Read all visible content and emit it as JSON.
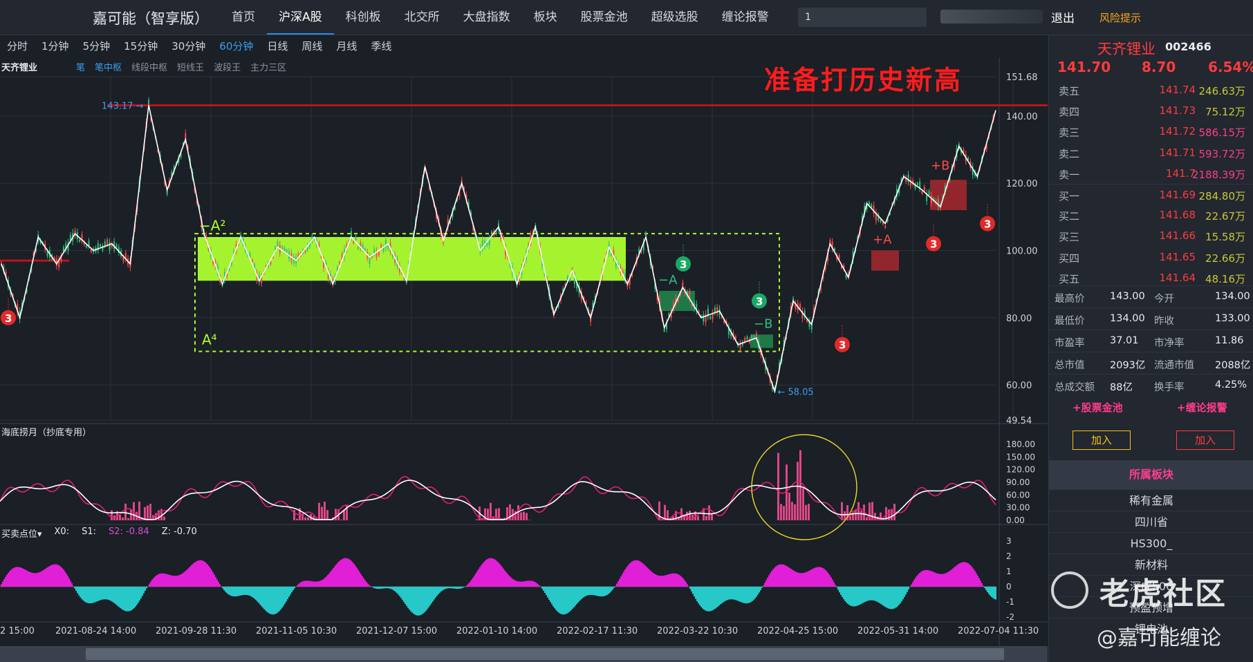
{
  "topbar": {
    "brand": "嘉可能（智享版）",
    "nav": [
      "首页",
      "沪深A股",
      "科创板",
      "北交所",
      "大盘指数",
      "板块",
      "股票金池",
      "超级选股",
      "缠论报警"
    ],
    "nav_active": 1,
    "search_value": "1",
    "logout": "退出",
    "risk": "风险提示"
  },
  "periods": [
    "分时",
    "1分钟",
    "5分钟",
    "15分钟",
    "30分钟",
    "60分钟",
    "日线",
    "周线",
    "月线",
    "季线"
  ],
  "period_active": 5,
  "toolrow": {
    "stock": "天齐锂业",
    "chips": [
      "笔",
      "笔中枢",
      "线段中枢",
      "短线王",
      "波段王",
      "主力三区"
    ],
    "chips_on": [
      0,
      1
    ]
  },
  "headline": "准备打历史新高",
  "chart_data": [
    {
      "type": "line",
      "name": "60-minute price chart",
      "y_ticks": [
        "151.68",
        "140.00",
        "120.00",
        "100.00",
        "80.00",
        "60.00",
        "49.54"
      ],
      "ylim": [
        49.54,
        151.68
      ],
      "x_tick_labels": [
        "2 15:00",
        "2021-08-24 14:00",
        "2021-09-28 11:30",
        "2021-11-05 10:30",
        "2021-12-07 15:00",
        "2022-01-10 14:00",
        "2022-02-17 11:30",
        "2022-03-22 10:30",
        "2022-04-25 15:00",
        "2022-05-31 14:00",
        "2022-07-04 11:30"
      ],
      "stroke_pivots": [
        96,
        80,
        104,
        96,
        105,
        100,
        102,
        96,
        143.17,
        118,
        133,
        105,
        90,
        104,
        91,
        101,
        97,
        104,
        90,
        104,
        98,
        102,
        91,
        125,
        103,
        120,
        100,
        107,
        90,
        107,
        81,
        94,
        80,
        101,
        90,
        104,
        77,
        89,
        80,
        82,
        72,
        74,
        58.05,
        85,
        78,
        102,
        92,
        114,
        108,
        122,
        118,
        113,
        131,
        122,
        141.7
      ],
      "annotations": {
        "high_label": "143.17",
        "low_label": "58.05",
        "resistance": 143.17,
        "zone_labels": [
          "−A²",
          "A⁴",
          "−A",
          "−B",
          "+A",
          "+B",
          "+B"
        ],
        "signal_marker": "3"
      }
    },
    {
      "type": "line",
      "name": "海底捞月（抄底专用）",
      "y_ticks": [
        "180.00",
        "150.00",
        "120.00",
        "90.00",
        "60.00",
        "30.00",
        "0.00"
      ],
      "ylim": [
        0,
        180
      ]
    },
    {
      "type": "bar",
      "name": "买卖点位",
      "y_ticks": [
        "3",
        "2",
        "1",
        "0",
        "-1",
        "-2"
      ],
      "ylim": [
        -2,
        3
      ]
    }
  ],
  "sub1_title": "海底捞月（抄底专用）",
  "sub2": {
    "title": "买卖点位▾",
    "x0": "X0:",
    "s1": "S1:",
    "s2_label": "S2:",
    "s2_val": "-0.84",
    "z": "Z:  -0.70"
  },
  "panel": {
    "name": "天齐锂业",
    "code": "002466",
    "price": "141.70",
    "change": "8.70",
    "pct": "6.54%",
    "asks": [
      {
        "label": "卖五",
        "price": "141.74",
        "vol": "246.63万",
        "color": "#c9c934"
      },
      {
        "label": "卖四",
        "price": "141.73",
        "vol": "75.12万",
        "color": "#c9c934"
      },
      {
        "label": "卖三",
        "price": "141.72",
        "vol": "586.15万",
        "color": "#ff3c8c"
      },
      {
        "label": "卖二",
        "price": "141.71",
        "vol": "593.72万",
        "color": "#ff3c8c"
      },
      {
        "label": "卖一",
        "price": "141.7",
        "vol": "2188.39万",
        "color": "#ff3c8c"
      }
    ],
    "bids": [
      {
        "label": "买一",
        "price": "141.69",
        "vol": "284.80万",
        "color": "#c9c934"
      },
      {
        "label": "买二",
        "price": "141.68",
        "vol": "22.67万",
        "color": "#c9c934"
      },
      {
        "label": "买三",
        "price": "141.66",
        "vol": "15.58万",
        "color": "#c9c934"
      },
      {
        "label": "买四",
        "price": "141.65",
        "vol": "22.66万",
        "color": "#c9c934"
      },
      {
        "label": "买五",
        "price": "141.64",
        "vol": "48.16万",
        "color": "#c9c934"
      }
    ],
    "stats": [
      [
        "最高价",
        "143.00",
        "今开",
        "134.00"
      ],
      [
        "最低价",
        "134.00",
        "昨收",
        "133.00"
      ],
      [
        "市盈率",
        "37.01",
        "市净率",
        "11.86"
      ],
      [
        "总市值",
        "2093亿",
        "流通市值",
        "2088亿"
      ],
      [
        "总成交额",
        "88亿",
        "换手率",
        "4.25%"
      ]
    ],
    "pool_btn": "+股票金池",
    "alert_btn": "+缠论报警",
    "add1": "加入",
    "add2": "加入",
    "sector_head": "所属板块",
    "sectors": [
      "稀有金属",
      "四川省",
      "HS300_",
      "新材料",
      "深成500",
      "预盈预增",
      "锂电池"
    ]
  },
  "watermark": {
    "brand": "老虎社区",
    "author": "@嘉可能缠论"
  },
  "colors": {
    "up": "#ff3c3c",
    "down": "#2ec27e",
    "zone_main": "#adff2f",
    "accent": "#3b9ef0",
    "magenta": "#e01fd6",
    "cyan": "#27c8c8"
  }
}
